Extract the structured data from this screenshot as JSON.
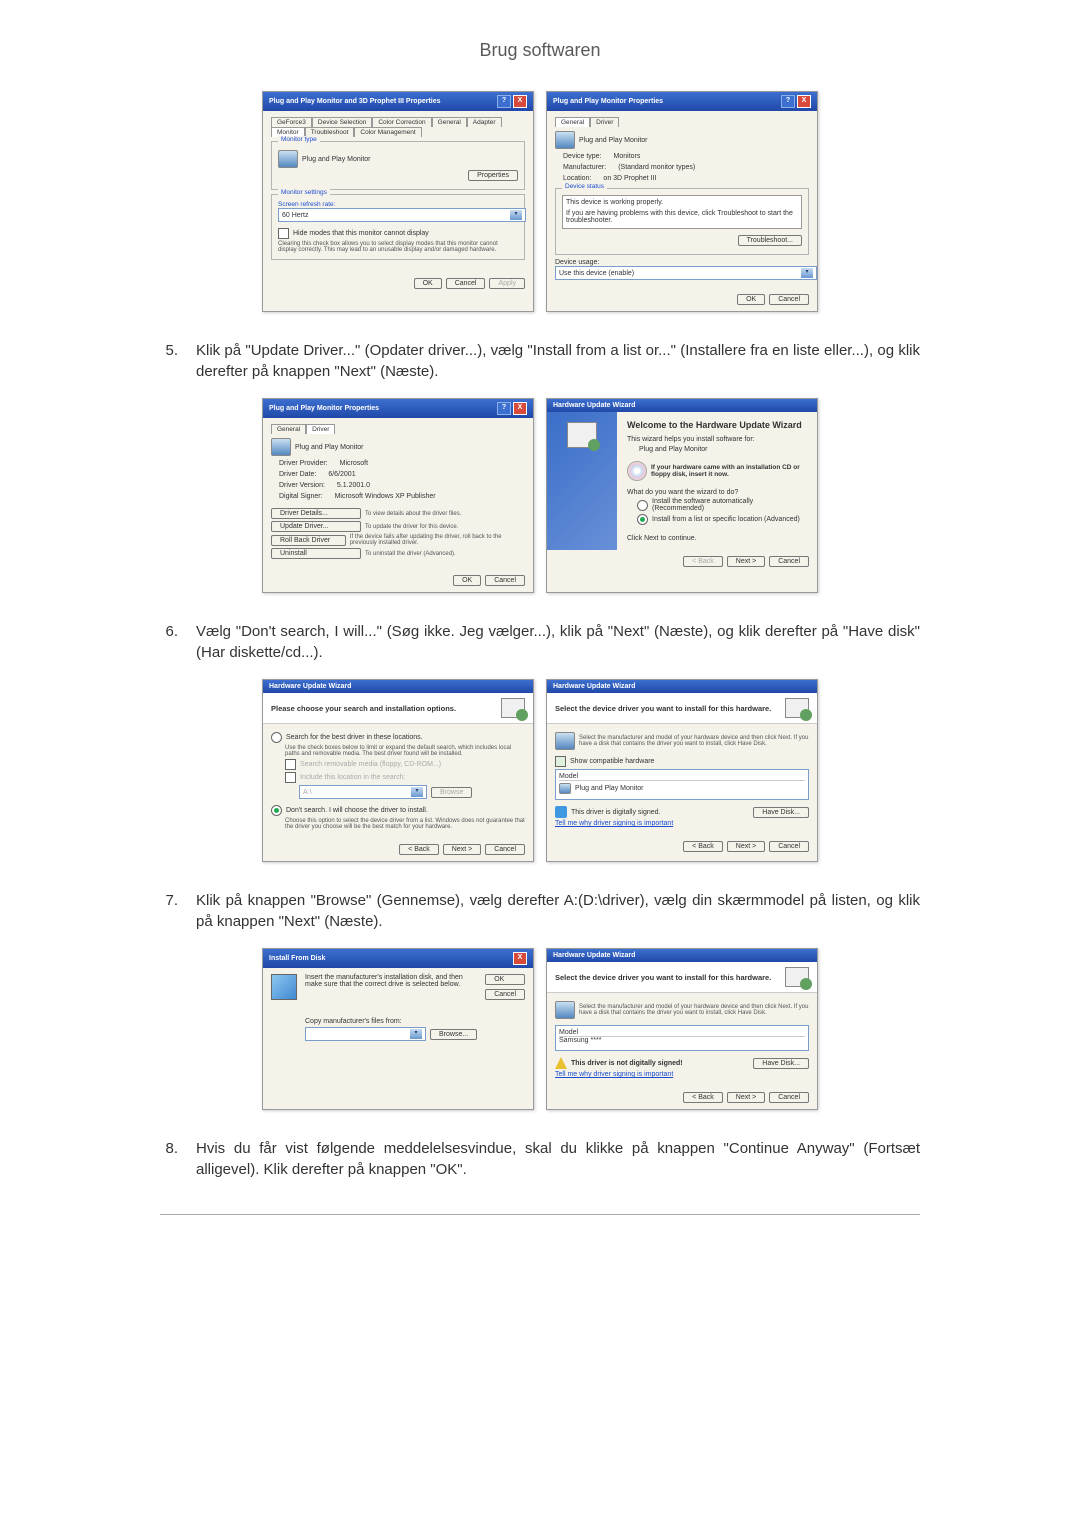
{
  "page_title": "Brug softwaren",
  "dialog1a": {
    "title": "Plug and Play Monitor and 3D Prophet III Properties",
    "tabs": [
      "GeForce3",
      "Device Selection",
      "Color Correction",
      "General",
      "Adapter",
      "Monitor",
      "Troubleshoot",
      "Color Management"
    ],
    "monitor_type_title": "Monitor type",
    "monitor_name": "Plug and Play Monitor",
    "properties_btn": "Properties",
    "monitor_settings_title": "Monitor settings",
    "refresh_label": "Screen refresh rate:",
    "refresh_value": "60 Hertz",
    "hide_modes": "Hide modes that this monitor cannot display",
    "hide_modes_help": "Clearing this check box allows you to select display modes that this monitor cannot display correctly. This may lead to an unusable display and/or damaged hardware.",
    "ok": "OK",
    "cancel": "Cancel",
    "apply": "Apply"
  },
  "dialog1b": {
    "title": "Plug and Play Monitor Properties",
    "tabs": [
      "General",
      "Driver"
    ],
    "device_name": "Plug and Play Monitor",
    "device_type_l": "Device type:",
    "device_type_v": "Monitors",
    "manufacturer_l": "Manufacturer:",
    "manufacturer_v": "(Standard monitor types)",
    "location_l": "Location:",
    "location_v": "on 3D Prophet III",
    "status_title": "Device status",
    "status_text": "This device is working properly.",
    "status_help": "If you are having problems with this device, click Troubleshoot to start the troubleshooter.",
    "troubleshoot_btn": "Troubleshoot...",
    "usage_label": "Device usage:",
    "usage_value": "Use this device (enable)",
    "ok": "OK",
    "cancel": "Cancel"
  },
  "step5": "Klik på \"Update Driver...\" (Opdater driver...), vælg \"Install from a list or...\" (Installere fra en liste eller...), og klik derefter på knappen \"Next\" (Næste).",
  "dialog2a": {
    "title": "Plug and Play Monitor Properties",
    "tabs": [
      "General",
      "Driver"
    ],
    "device_name": "Plug and Play Monitor",
    "provider_l": "Driver Provider:",
    "provider_v": "Microsoft",
    "date_l": "Driver Date:",
    "date_v": "6/6/2001",
    "version_l": "Driver Version:",
    "version_v": "5.1.2001.0",
    "signer_l": "Digital Signer:",
    "signer_v": "Microsoft Windows XP Publisher",
    "details_btn": "Driver Details...",
    "details_d": "To view details about the driver files.",
    "update_btn": "Update Driver...",
    "update_d": "To update the driver for this device.",
    "rollback_btn": "Roll Back Driver",
    "rollback_d": "If the device fails after updating the driver, roll back to the previously installed driver.",
    "uninstall_btn": "Uninstall",
    "uninstall_d": "To uninstall the driver (Advanced).",
    "ok": "OK",
    "cancel": "Cancel"
  },
  "dialog2b": {
    "title": "Hardware Update Wizard",
    "welcome": "Welcome to the Hardware Update Wizard",
    "helps": "This wizard helps you install software for:",
    "dev": "Plug and Play Monitor",
    "cd_hint": "If your hardware came with an installation CD or floppy disk, insert it now.",
    "question": "What do you want the wizard to do?",
    "opt1": "Install the software automatically (Recommended)",
    "opt2": "Install from a list or specific location (Advanced)",
    "click_next": "Click Next to continue.",
    "back": "< Back",
    "next": "Next >",
    "cancel": "Cancel"
  },
  "step6": "Vælg \"Don't search, I will...\" (Søg ikke. Jeg vælger...), klik på \"Next\" (Næste), og klik derefter på \"Have disk\" (Har diskette/cd...).",
  "dialog3a": {
    "title": "Hardware Update Wizard",
    "header": "Please choose your search and installation options.",
    "opt1": "Search for the best driver in these locations.",
    "opt1_desc": "Use the check boxes below to limit or expand the default search, which includes local paths and removable media. The best driver found will be installed.",
    "cb1": "Search removable media (floppy, CD-ROM...)",
    "cb2": "Include this location in the search:",
    "path": "A:\\",
    "browse": "Browse",
    "opt2": "Don't search. I will choose the driver to install.",
    "opt2_desc": "Choose this option to select the device driver from a list. Windows does not guarantee that the driver you choose will be the best match for your hardware.",
    "back": "< Back",
    "next": "Next >",
    "cancel": "Cancel"
  },
  "dialog3b": {
    "title": "Hardware Update Wizard",
    "header": "Select the device driver you want to install for this hardware.",
    "desc": "Select the manufacturer and model of your hardware device and then click Next. If you have a disk that contains the driver you want to install, click Have Disk.",
    "compat": "Show compatible hardware",
    "model_h": "Model",
    "model_v": "Plug and Play Monitor",
    "signed": "This driver is digitally signed.",
    "tell": "Tell me why driver signing is important",
    "have_disk": "Have Disk...",
    "back": "< Back",
    "next": "Next >",
    "cancel": "Cancel"
  },
  "step7": "Klik på knappen \"Browse\" (Gennemse), vælg derefter A:(D:\\driver), vælg din skærmmodel på listen, og klik på knappen \"Next\" (Næste).",
  "dialog4a": {
    "title": "Install From Disk",
    "desc": "Insert the manufacturer's installation disk, and then make sure that the correct drive is selected below.",
    "copy_label": "Copy manufacturer's files from:",
    "ok": "OK",
    "cancel": "Cancel",
    "browse": "Browse..."
  },
  "dialog4b": {
    "title": "Hardware Update Wizard",
    "header": "Select the device driver you want to install for this hardware.",
    "desc": "Select the manufacturer and model of your hardware device and then click Next. If you have a disk that contains the driver you want to install, click Have Disk.",
    "model_h": "Model",
    "model_v": "Samsung ****",
    "not_signed": "This driver is not digitally signed!",
    "tell": "Tell me why driver signing is important",
    "have_disk": "Have Disk...",
    "back": "< Back",
    "next": "Next >",
    "cancel": "Cancel"
  },
  "step8": "Hvis du får vist følgende meddelelsesvindue, skal du klikke på knappen \"Continue Anyway\" (Fortsæt alligevel). Klik derefter på knappen \"OK\"."
}
